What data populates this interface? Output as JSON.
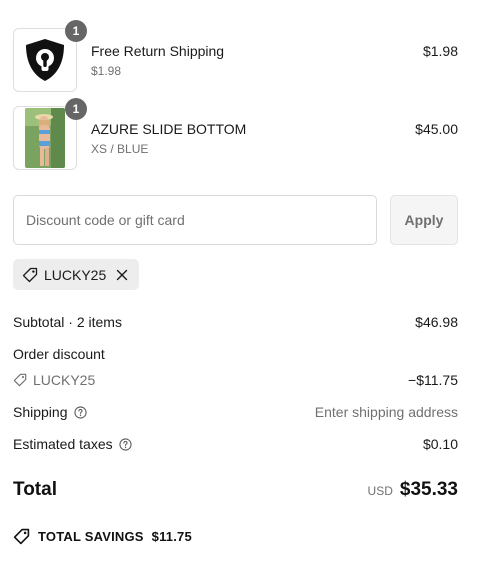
{
  "line_items": [
    {
      "name": "Free Return Shipping",
      "subtitle": "$1.98",
      "price": "$1.98",
      "quantity": "1",
      "image_icon": "shield-lock-icon"
    },
    {
      "name": "AZURE SLIDE BOTTOM",
      "subtitle": "XS / BLUE",
      "price": "$45.00",
      "quantity": "1",
      "image_icon": "product-photo"
    }
  ],
  "discount": {
    "placeholder": "Discount code or gift card",
    "apply_label": "Apply",
    "applied_code": "LUCKY25"
  },
  "summary": {
    "subtotal_label": "Subtotal · 2 items",
    "subtotal_value": "$46.98",
    "order_discount_label": "Order discount",
    "discount_code": "LUCKY25",
    "discount_value": "−$11.75",
    "shipping_label": "Shipping",
    "shipping_value": "Enter shipping address",
    "taxes_label": "Estimated taxes",
    "taxes_value": "$0.10",
    "total_label": "Total",
    "currency": "USD",
    "total_value": "$35.33",
    "savings_label": "TOTAL SAVINGS",
    "savings_value": "$11.75"
  },
  "colors": {
    "text": "#1a1a1a",
    "muted": "#707070",
    "badge": "#666666",
    "tag_bg": "#ededed"
  }
}
